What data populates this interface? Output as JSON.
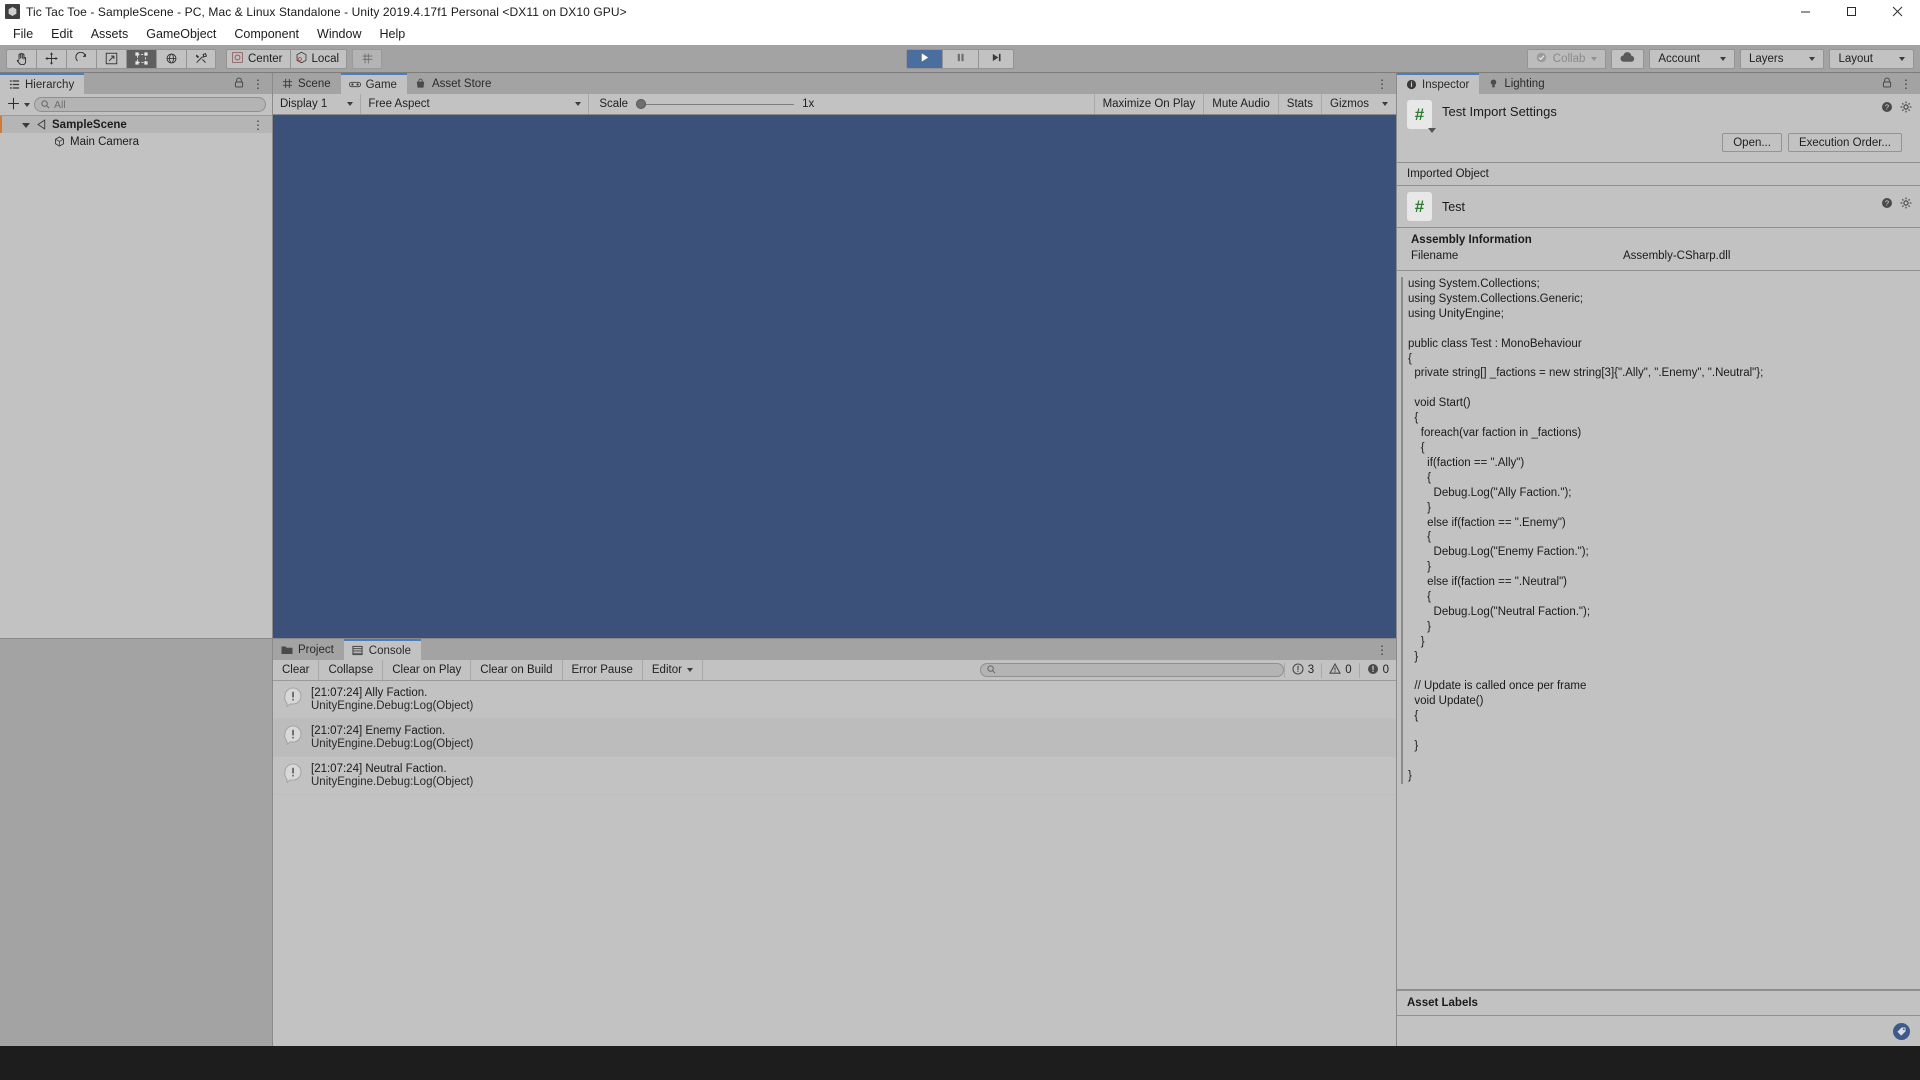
{
  "window": {
    "title": "Tic Tac Toe - SampleScene - PC, Mac & Linux Standalone - Unity 2019.4.17f1 Personal <DX11 on DX10 GPU>",
    "app_icon": "unity-icon",
    "minimize": "minimize-icon",
    "maximize": "maximize-icon",
    "close": "close-icon"
  },
  "menu": {
    "items": [
      "File",
      "Edit",
      "Assets",
      "GameObject",
      "Component",
      "Window",
      "Help"
    ]
  },
  "toolbar": {
    "tools": [
      {
        "name": "hand-tool",
        "icon": "hand-icon",
        "active": false
      },
      {
        "name": "move-tool",
        "icon": "move-icon",
        "active": false
      },
      {
        "name": "rotate-tool",
        "icon": "rotate-icon",
        "active": false
      },
      {
        "name": "scale-tool",
        "icon": "scale-icon",
        "active": false
      },
      {
        "name": "rect-tool",
        "icon": "rect-icon",
        "active": true
      },
      {
        "name": "transform-tool",
        "icon": "globe-icon",
        "active": false
      },
      {
        "name": "custom-tool",
        "icon": "wrench-icon",
        "active": false
      }
    ],
    "pivot_label": "Center",
    "space_label": "Local",
    "grid_label": "grid-snap-icon",
    "play": "play-icon",
    "pause": "pause-icon",
    "step": "step-icon",
    "collab_label": "Collab",
    "cloud_label": "cloud-icon",
    "account_label": "Account",
    "layers_label": "Layers",
    "layout_label": "Layout"
  },
  "hierarchy": {
    "tab_label": "Hierarchy",
    "tab_icon": "hierarchy-icon",
    "lock_icon": "lock-icon",
    "menu_icon": "kebab-menu-icon",
    "add_label": "+",
    "search_placeholder": "All",
    "search_value": "",
    "search_icon": "search-icon",
    "items": [
      {
        "label": "SampleScene",
        "icon": "scene-icon",
        "depth": 0,
        "expanded": true,
        "selected": true,
        "bold": true
      },
      {
        "label": "Main Camera",
        "icon": "gameobject-icon",
        "depth": 1,
        "expanded": false,
        "selected": false,
        "bold": false
      }
    ]
  },
  "centerview": {
    "tabs": [
      {
        "label": "Scene",
        "icon": "scene-grid-icon",
        "active": false
      },
      {
        "label": "Game",
        "icon": "gamepad-icon",
        "active": true
      },
      {
        "label": "Asset Store",
        "icon": "store-icon",
        "active": false
      }
    ],
    "menu_icon": "kebab-menu-icon",
    "display_label": "Display 1",
    "aspect_label": "Free Aspect",
    "scale_label": "Scale",
    "scale_value": "1x",
    "maximize_label": "Maximize On Play",
    "mute_label": "Mute Audio",
    "stats_label": "Stats",
    "gizmos_label": "Gizmos",
    "game_bg_color": "#3c5179"
  },
  "console": {
    "tabs": [
      {
        "label": "Project",
        "icon": "folder-icon",
        "active": false
      },
      {
        "label": "Console",
        "icon": "console-icon",
        "active": true
      }
    ],
    "menu_icon": "kebab-menu-icon",
    "buttons": [
      "Clear",
      "Collapse",
      "Clear on Play",
      "Clear on Build",
      "Error Pause"
    ],
    "editor_label": "Editor",
    "search_placeholder": "",
    "search_value": "",
    "search_icon": "search-icon",
    "counts": {
      "info": "3",
      "warning": "0",
      "error": "0"
    },
    "messages": [
      {
        "icon": "info-icon",
        "line1": "[21:07:24] Ally Faction.",
        "line2": "UnityEngine.Debug:Log(Object)"
      },
      {
        "icon": "info-icon",
        "line1": "[21:07:24] Enemy Faction.",
        "line2": "UnityEngine.Debug:Log(Object)"
      },
      {
        "icon": "info-icon",
        "line1": "[21:07:24] Neutral Faction.",
        "line2": "UnityEngine.Debug:Log(Object)"
      }
    ]
  },
  "inspector": {
    "tabs": [
      {
        "label": "Inspector",
        "icon": "info-circle-icon",
        "active": true
      },
      {
        "label": "Lighting",
        "icon": "bulb-icon",
        "active": false
      }
    ],
    "lock_icon": "lock-icon",
    "menu_icon": "kebab-menu-icon",
    "title": "Test Import Settings",
    "script_icon": "csharp-script-icon",
    "help_icon": "help-icon",
    "gear_icon": "gear-icon",
    "open_label": "Open...",
    "execution_order_label": "Execution Order...",
    "imported_object_label": "Imported Object",
    "object_name": "Test",
    "assembly_header": "Assembly Information",
    "assembly_key": "Filename",
    "assembly_value": "Assembly-CSharp.dll",
    "asset_labels_header": "Asset Labels",
    "label_icon": "tag-icon",
    "code": [
      "using System.Collections;",
      "using System.Collections.Generic;",
      "using UnityEngine;",
      "",
      "public class Test : MonoBehaviour",
      "{",
      "  private string[] _factions = new string[3]{\".Ally\", \".Enemy\", \".Neutral\"};",
      "",
      "  void Start()",
      "  {",
      "    foreach(var faction in _factions)",
      "    {",
      "      if(faction == \".Ally\")",
      "      {",
      "        Debug.Log(\"Ally Faction.\");",
      "      }",
      "      else if(faction == \".Enemy\")",
      "      {",
      "        Debug.Log(\"Enemy Faction.\");",
      "      }",
      "      else if(faction == \".Neutral\")",
      "      {",
      "        Debug.Log(\"Neutral Faction.\");",
      "      }",
      "    }",
      "  }",
      "",
      "  // Update is called once per frame",
      "  void Update()",
      "  {",
      "",
      "  }",
      "",
      "}"
    ]
  }
}
